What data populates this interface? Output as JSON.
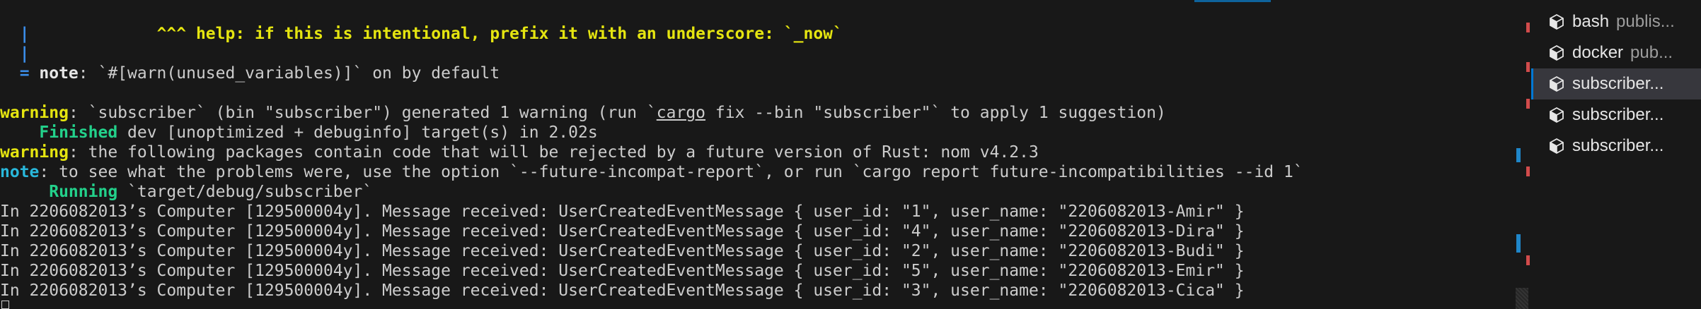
{
  "terminal": {
    "help_gutter_1": "  |",
    "help_text": "^^^ help: if this is intentional, prefix it with an underscore: `_now`",
    "help_gutter_2": "  |",
    "note_eq": "  = ",
    "note_label": "note",
    "note_text": ": `#[warn(unused_variables)]` on by default",
    "warning1_label": "warning",
    "warning1_text_a": ": `subscriber` (bin \"subscriber\") generated 1 warning (run `",
    "warning1_cargo": "cargo",
    "warning1_text_b": " fix --bin \"subscriber\"` to apply 1 suggestion)",
    "finished_label": "    Finished",
    "finished_text": " dev [unoptimized + debuginfo] target(s) in 2.02s",
    "warning2_label": "warning",
    "warning2_text": ": the following packages contain code that will be rejected by a future version of Rust: nom v4.2.3",
    "note2_label": "note",
    "note2_text": ": to see what the problems were, use the option `--future-incompat-report`, or run `cargo report future-incompatibilities --id 1`",
    "running_label": "     Running",
    "running_text": " `target/debug/subscriber`",
    "messages": [
      "In 2206082013’s Computer [129500004y]. Message received: UserCreatedEventMessage { user_id: \"1\", user_name: \"2206082013-Amir\" }",
      "In 2206082013’s Computer [129500004y]. Message received: UserCreatedEventMessage { user_id: \"4\", user_name: \"2206082013-Dira\" }",
      "In 2206082013’s Computer [129500004y]. Message received: UserCreatedEventMessage { user_id: \"2\", user_name: \"2206082013-Budi\" }",
      "In 2206082013’s Computer [129500004y]. Message received: UserCreatedEventMessage { user_id: \"5\", user_name: \"2206082013-Emir\" }",
      "In 2206082013’s Computer [129500004y]. Message received: UserCreatedEventMessage { user_id: \"3\", user_name: \"2206082013-Cica\" }"
    ]
  },
  "tabs": [
    {
      "name": "bash",
      "desc": "publis...",
      "icon": "cube-icon"
    },
    {
      "name": "docker",
      "desc": "pub...",
      "icon": "cube-icon"
    },
    {
      "name": "subscriber...",
      "desc": "",
      "icon": "cube-icon"
    },
    {
      "name": "subscriber...",
      "desc": "",
      "icon": "cube-icon"
    },
    {
      "name": "subscriber...",
      "desc": "",
      "icon": "cube-icon"
    }
  ],
  "active_tab_index": 2,
  "colors": {
    "background": "#181818",
    "warning": "#e5e510",
    "note": "#29b8db",
    "gutter": "#3b8eea",
    "success": "#23d18b",
    "accent": "#0078d4"
  }
}
